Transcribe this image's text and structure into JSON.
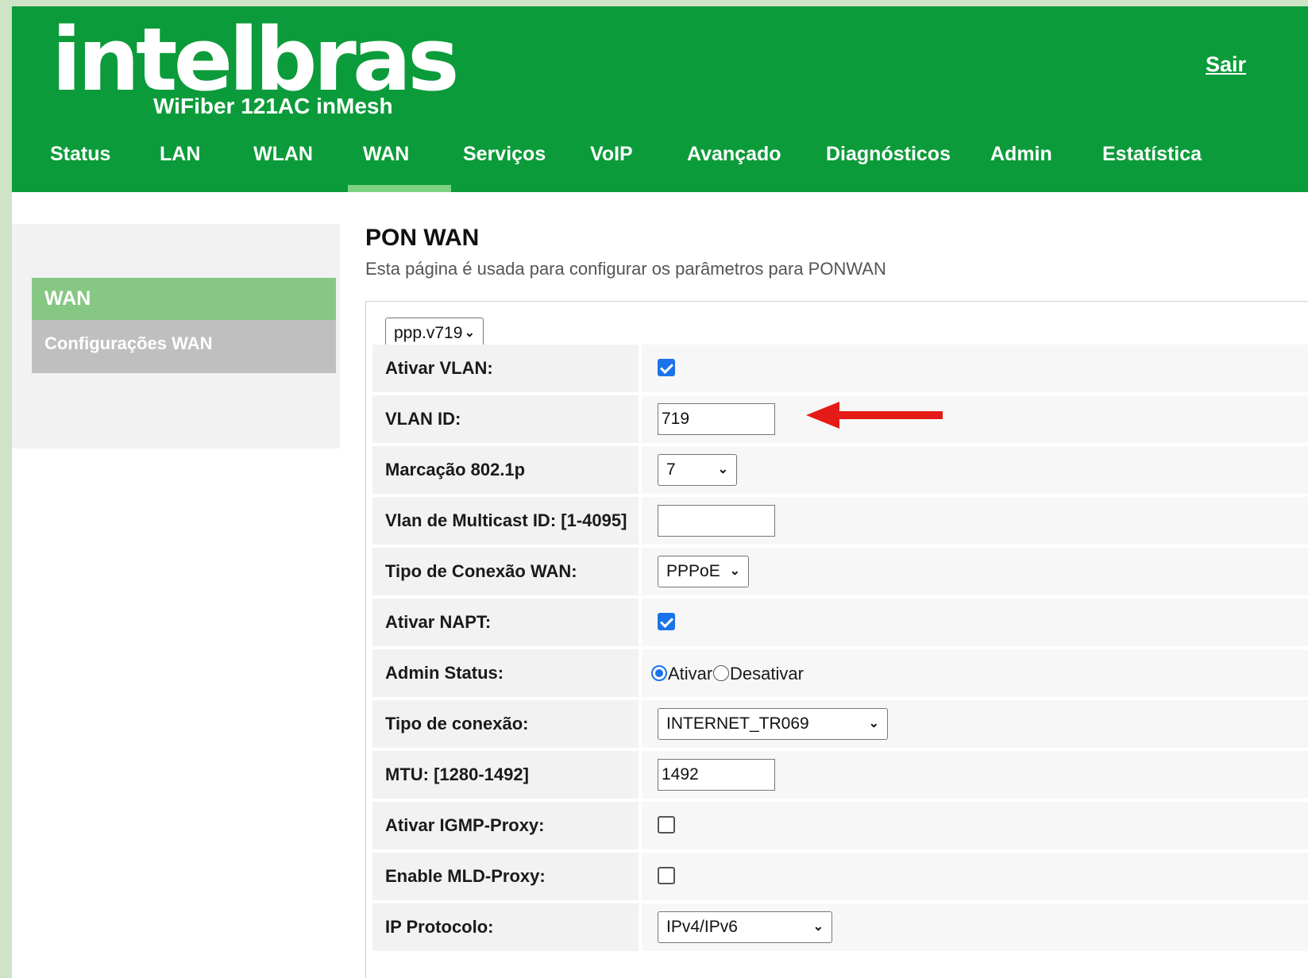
{
  "header": {
    "logo_text": "intelbras",
    "model": "WiFiber 121AC inMesh",
    "logout_label": "Sair",
    "bg_color": "#0c9b3a"
  },
  "nav": {
    "items": [
      "Status",
      "LAN",
      "WLAN",
      "WAN",
      "Serviços",
      "VoIP",
      "Avançado",
      "Diagnósticos",
      "Admin",
      "Estatística"
    ],
    "active": "WAN"
  },
  "sidebar": {
    "section_title": "WAN",
    "items": [
      "Configurações WAN"
    ]
  },
  "main": {
    "title": "PON WAN",
    "description": "Esta página é usada para configurar os parâmetros para PONWAN",
    "wan_select": "ppp.v719",
    "rows": {
      "vlan_enable": {
        "label": "Ativar VLAN:",
        "checked": true
      },
      "vlan_id": {
        "label": "VLAN ID:",
        "value": "719"
      },
      "priority": {
        "label": "Marcação 802.1p",
        "value": "7"
      },
      "multicast_vlan": {
        "label": "Vlan de Multicast ID: [1-4095]",
        "value": ""
      },
      "conn_type": {
        "label": "Tipo de Conexão WAN:",
        "value": "PPPoE"
      },
      "napt": {
        "label": "Ativar NAPT:",
        "checked": true
      },
      "admin_status": {
        "label": "Admin Status:",
        "option_on": "Ativar",
        "option_off": "Desativar",
        "selected": "Ativar"
      },
      "service_type": {
        "label": "Tipo de conexão:",
        "value": "INTERNET_TR069"
      },
      "mtu": {
        "label": "MTU: [1280-1492]",
        "value": "1492"
      },
      "igmp": {
        "label": "Ativar IGMP-Proxy:",
        "checked": false
      },
      "mld": {
        "label": "Enable MLD-Proxy:",
        "checked": false
      },
      "ip_protocol": {
        "label": "IP Protocolo:",
        "value": "IPv4/IPv6"
      }
    }
  },
  "annotation": {
    "arrow_color": "#e41b17",
    "icon": "arrow-left-icon"
  }
}
